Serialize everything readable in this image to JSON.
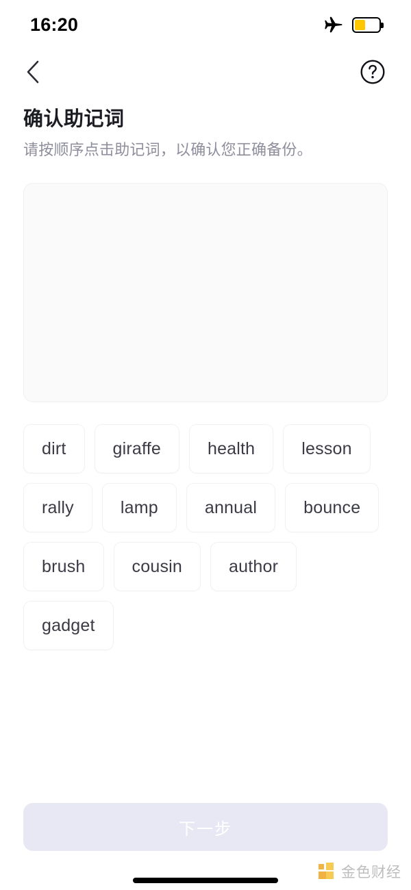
{
  "status_bar": {
    "time": "16:20",
    "airplane_icon": "airplane-mode-icon",
    "battery_icon": "battery-low-power-icon",
    "battery_color": "#ffc700",
    "battery_level_percent": 40
  },
  "nav": {
    "back_icon": "chevron-left-icon",
    "help_icon": "question-circle-icon"
  },
  "heading": {
    "title": "确认助记词",
    "subtitle": "请按顺序点击助记词，以确认您正确备份。"
  },
  "answer_panel": {
    "selected_words": [],
    "background_color": "#fafafa",
    "border_color": "#f0f0f2"
  },
  "word_bank": {
    "words": [
      "dirt",
      "giraffe",
      "health",
      "lesson",
      "rally",
      "lamp",
      "annual",
      "bounce",
      "brush",
      "cousin",
      "author",
      "gadget"
    ]
  },
  "footer": {
    "next_label": "下一步",
    "next_enabled": false,
    "next_bg_color": "#e8e8f4",
    "next_text_color": "#ffffff"
  },
  "watermark": {
    "text": "金色财经",
    "logo": "jinse-finance-logo",
    "logo_color": "#f0a92a"
  }
}
